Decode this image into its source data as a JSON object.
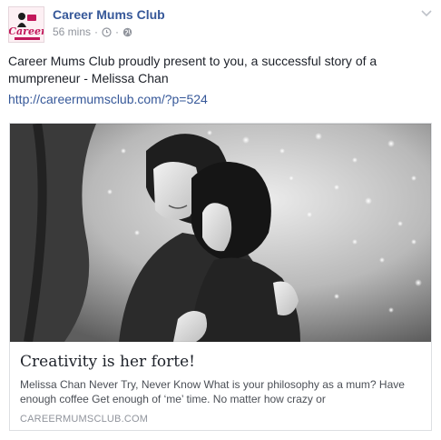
{
  "post": {
    "author": "Career Mums Club",
    "avatar_text": "Career",
    "time": "56 mins",
    "dot": "·",
    "text": "Career Mums Club proudly present to you, a successful story of a mumpreneur - Melissa Chan",
    "link": "http://careermumsclub.com/?p=524"
  },
  "card": {
    "title": "Creativity is her forte!",
    "description": "Melissa Chan Never Try, Never Know What is your philosophy as a mum? Have enough coffee Get enough of ‘me’ time. No matter how crazy or",
    "domain": "CAREERMUMSCLUB.COM"
  },
  "icons": {
    "clock": "clock-icon",
    "globe": "globe-icon",
    "chevron": "chevron-down-icon"
  },
  "colors": {
    "link": "#365899",
    "meta": "#90949c",
    "brand_pink": "#c2185b"
  }
}
